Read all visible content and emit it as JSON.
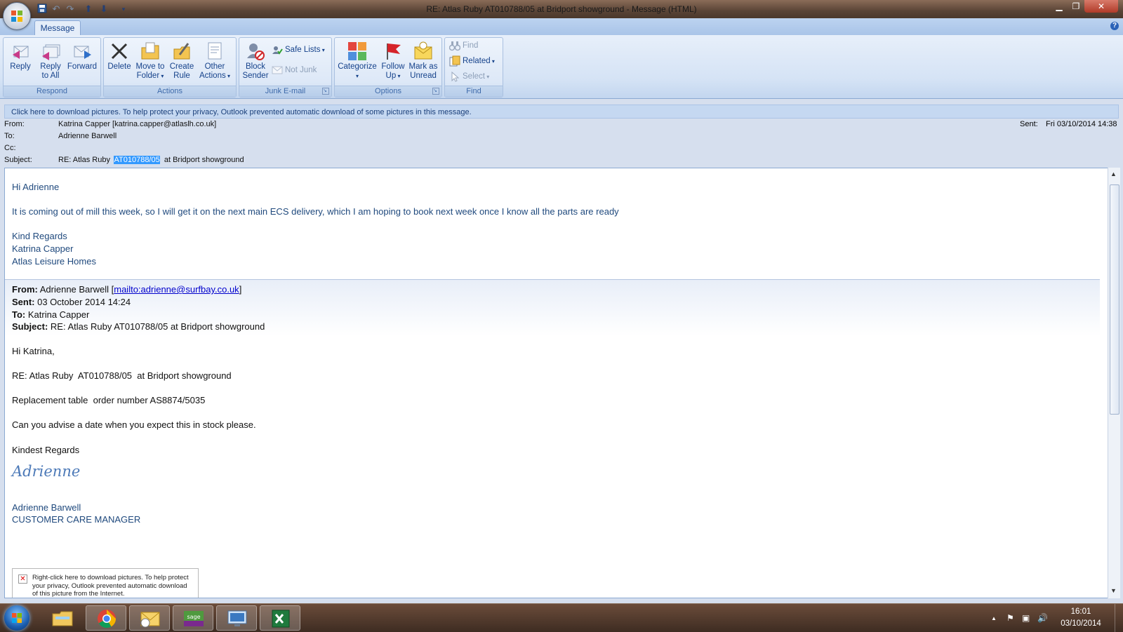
{
  "window": {
    "title": "RE: Atlas Ruby  AT010788/05  at Bridport showground  -  Message (HTML)"
  },
  "ribbon": {
    "tab": "Message",
    "groups": {
      "respond": {
        "label": "Respond",
        "reply": "Reply",
        "reply_all_1": "Reply",
        "reply_all_2": "to All",
        "forward": "Forward"
      },
      "actions": {
        "label": "Actions",
        "delete": "Delete",
        "move_1": "Move to",
        "move_2": "Folder",
        "create_1": "Create",
        "create_2": "Rule",
        "other_1": "Other",
        "other_2": "Actions"
      },
      "junk": {
        "label": "Junk E-mail",
        "block_1": "Block",
        "block_2": "Sender",
        "safe_lists": "Safe Lists",
        "not_junk": "Not Junk"
      },
      "options": {
        "label": "Options",
        "categorize": "Categorize",
        "follow_1": "Follow",
        "follow_2": "Up",
        "mark_1": "Mark as",
        "mark_2": "Unread"
      },
      "find": {
        "label": "Find",
        "find": "Find",
        "related": "Related",
        "select": "Select"
      }
    }
  },
  "infobar": "Click here to download pictures. To help protect your privacy, Outlook prevented automatic download of some pictures in this message.",
  "header": {
    "from_label": "From:",
    "from_value": "Katrina Capper [katrina.capper@atlaslh.co.uk]",
    "to_label": "To:",
    "to_value": "Adrienne Barwell",
    "cc_label": "Cc:",
    "subject_label": "Subject:",
    "subject_pre": "RE: Atlas Ruby  ",
    "subject_highlight": "AT010788/05",
    "subject_post": "  at Bridport showground",
    "sent_label": "Sent:",
    "sent_value": "Fri 03/10/2014 14:38"
  },
  "body": {
    "greeting": "Hi Adrienne",
    "paragraph": "It is coming out of mill this week, so I will get it on the next main ECS delivery, which I am hoping to book next week once I know all the parts are ready",
    "regards": "Kind Regards",
    "sig_name": "Katrina Capper",
    "sig_company": "Atlas Leisure Homes",
    "quoted": {
      "from_label": "From:",
      "from_name": " Adrienne Barwell [",
      "from_link": "mailto:adrienne@surfbay.co.uk",
      "from_end": "]",
      "sent_label": "Sent:",
      "sent_value": " 03 October 2014 14:24",
      "to_label": "To:",
      "to_value": " Katrina Capper",
      "subject_label": "Subject:",
      "subject_value": " RE: Atlas Ruby AT010788/05 at Bridport showground",
      "greeting": "Hi Katrina,",
      "line1": "RE: Atlas Ruby  AT010788/05  at Bridport showground",
      "line2": "Replacement table  order number AS8874/5035",
      "line3": "Can you advise a date when you expect this in stock please.",
      "regards": "Kindest Regards",
      "signature": "Adrienne",
      "name": "Adrienne Barwell",
      "title": "CUSTOMER CARE MANAGER"
    },
    "image_placeholder": "Right-click here to download pictures.  To help protect your privacy, Outlook prevented automatic download of this picture from the Internet."
  },
  "taskbar": {
    "items": [
      "windows-explorer",
      "google-chrome",
      "outlook",
      "sage",
      "remote-desktop",
      "excel"
    ],
    "time": "16:01",
    "date": "03/10/2014"
  }
}
